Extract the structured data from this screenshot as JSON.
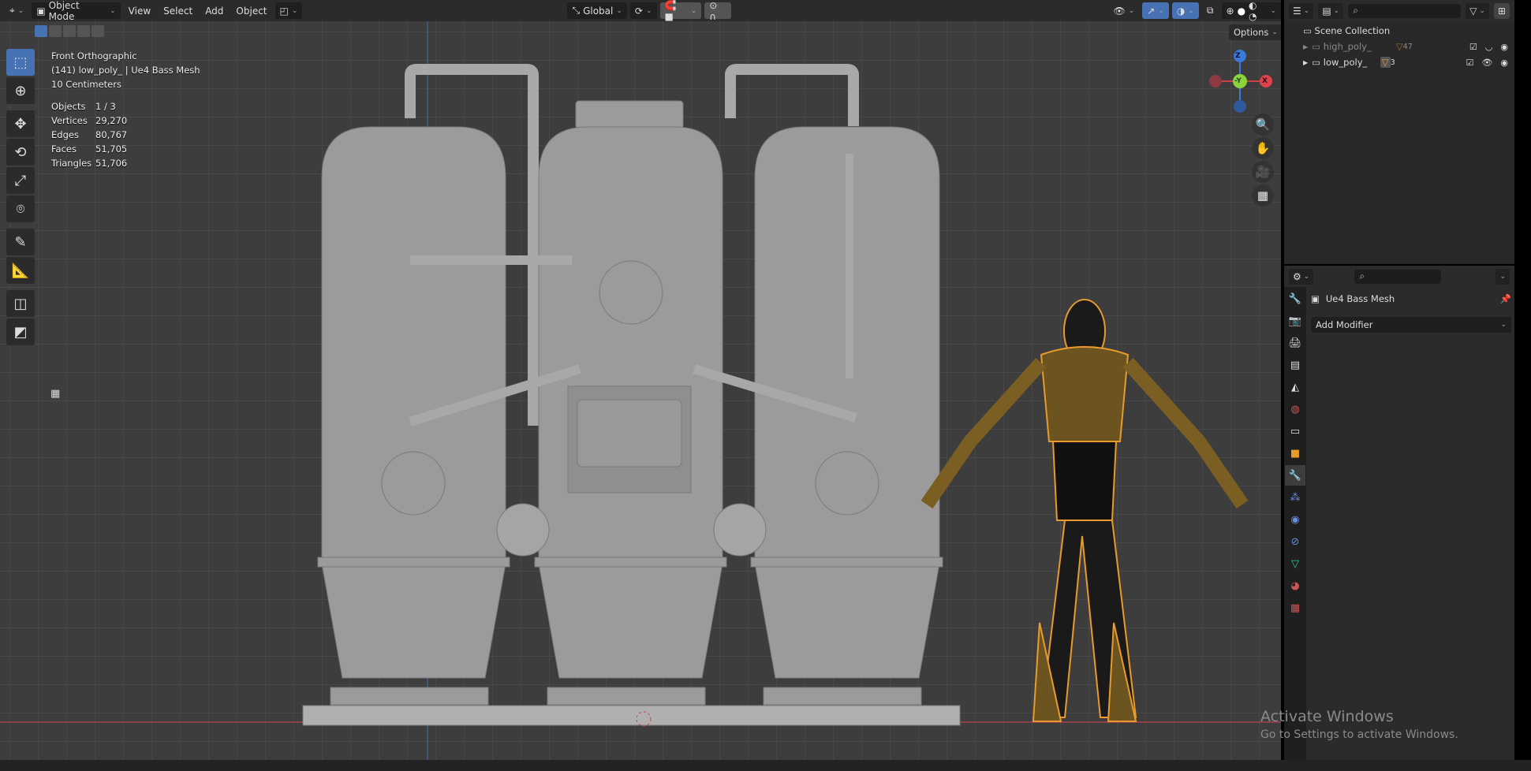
{
  "header": {
    "mode": "Object Mode",
    "menus": [
      "View",
      "Select",
      "Add",
      "Object"
    ],
    "orientation": "Global",
    "options": "Options"
  },
  "overlay": {
    "view": "Front Orthographic",
    "object": "(141) low_poly_ | Ue4 Bass Mesh",
    "scale": "10 Centimeters",
    "stats": [
      {
        "label": "Objects",
        "value": "1 / 3"
      },
      {
        "label": "Vertices",
        "value": "29,270"
      },
      {
        "label": "Edges",
        "value": "80,767"
      },
      {
        "label": "Faces",
        "value": "51,705"
      },
      {
        "label": "Triangles",
        "value": "51,706"
      }
    ]
  },
  "gizmo": {
    "z": "Z",
    "y": "-Y",
    "x": "X"
  },
  "outliner": {
    "root": "Scene Collection",
    "items": [
      {
        "name": "high_poly_",
        "count": "47"
      },
      {
        "name": "low_poly_",
        "count": "3"
      }
    ]
  },
  "properties": {
    "object": "Ue4 Bass Mesh",
    "add_modifier": "Add Modifier"
  },
  "watermark": {
    "title": "Activate Windows",
    "subtitle": "Go to Settings to activate Windows."
  },
  "colors": {
    "accent": "#4772b3",
    "selection": "#e89a2c",
    "x_axis": "#e0414e",
    "y_axis": "#8bd43a",
    "z_axis": "#3a7ad9"
  }
}
